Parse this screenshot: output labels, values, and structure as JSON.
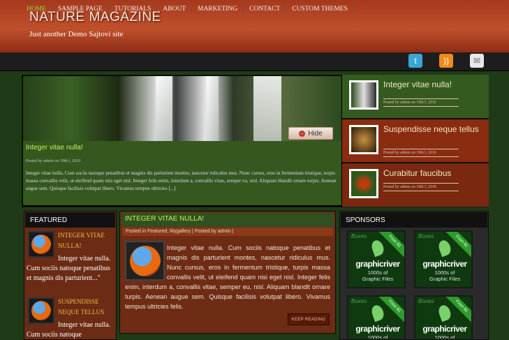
{
  "site": {
    "title": "NATURE MAGAZINE",
    "tagline": "Just another Demo Sajtovi site"
  },
  "nav": {
    "items": [
      "HOME",
      "SAMPLE PAGE",
      "TUTORIALS",
      "ABOUT",
      "MARKETING",
      "CONTACT",
      "CUSTOM THEMES"
    ],
    "active": "HOME"
  },
  "social": [
    {
      "icon": "twitter-icon",
      "color": "#3aa6d8"
    },
    {
      "icon": "rss-icon",
      "color": "#f08a1c"
    },
    {
      "icon": "mail-icon",
      "color": "#e8e8e8"
    }
  ],
  "slider": {
    "hide_label": "Hide",
    "title": "Integer vitae nulla!",
    "meta": "Posted by admin on 19th f, 2010",
    "text": "Integer vitae nulla. Cum sociis natoque penatibus et magnis dis parturient montes, nascetur ridiculus mus. Nunc cursus, eros in fermentum tristique, turpis massa convallis velit, ut eleifend quam nisi eget nisl. Integer felis enim, interdum a, convallis vitae, semper eu, nisl. Aliquam blandit ornare turpis. Aenean augue sem. Quisque facilisis volutpat libero. Vivamus tempus ultricies [...]",
    "items": [
      {
        "title": "Integer vitae nulla!",
        "meta": "Posted by admin on 19th f, 2010",
        "bg": "#355a1f"
      },
      {
        "title": "Suspendisse neque tellus",
        "meta": "Posted by admin on 19th f, 2010",
        "bg": "#8a2c10"
      },
      {
        "title": "Curabitur faucibus",
        "meta": "Posted by admin on 19th f, 2010",
        "bg": "#7a2810"
      }
    ]
  },
  "featured": {
    "heading": "FEATURED",
    "items": [
      {
        "title": "INTEGER VITAE NULLA!",
        "text": "Integer vitae nulla. Cum sociis natoque penatibus et magnis dis parturient...\""
      },
      {
        "title": "SUSPENDISSE NEQUE TELLUS",
        "text": "Integer vitae nulla. Cum sociis natoque"
      }
    ]
  },
  "post": {
    "title": "INTEGER VITAE NULLA!",
    "meta": "Posted in Featured, Mygallery | Posted by admin |",
    "text": "Integer vitae nulla. Cum sociis natoque penatibus et magnis dis parturient montes, nascetur ridiculus mus. Nunc cursus, eros in fermentum tristique, turpis massa convallis velit, ut eleifend quam nisi eget nisl. Integer felis enim, interdum a, convallis vitae, semper eu, nisl. Aliquam blandit ornare turpis. Aenean augue sem. Quisque facilisis volutpat libero. Vivamus tempus ultricies felis.",
    "button": "KEEP READING"
  },
  "sponsors": {
    "heading": "SPONSORS",
    "ad": {
      "boxes": "Boxes",
      "ribbon": "From $1",
      "brand": "graphicriver",
      "sub1": "1000s of",
      "sub2": "Graphic Files"
    }
  }
}
